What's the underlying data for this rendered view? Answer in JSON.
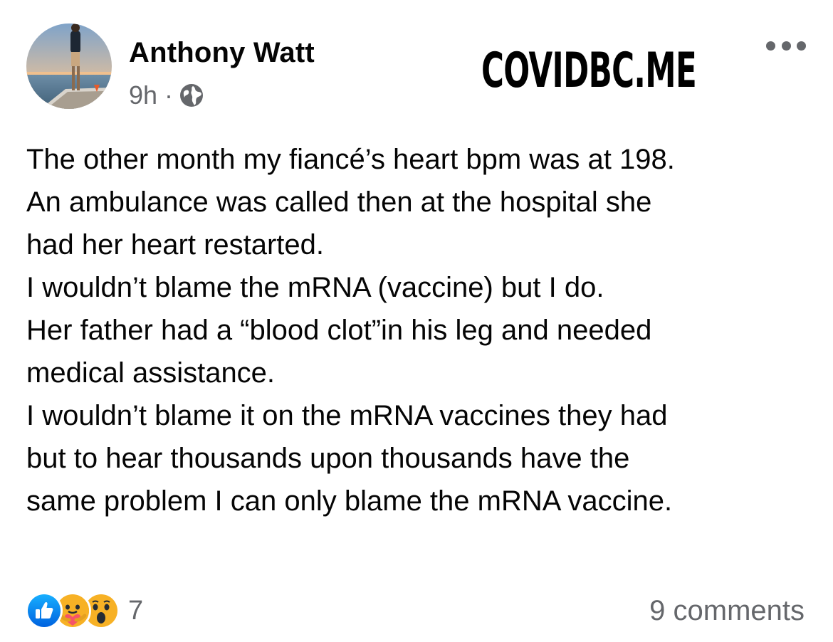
{
  "post": {
    "author": "Anthony Watt",
    "time": "9h",
    "separator": "·",
    "audience_icon": "globe-icon",
    "body_lines": [
      "The other month my fiancé’s heart bpm was at 198.",
      "An ambulance was called then at the hospital she",
      "had her heart restarted.",
      "I wouldn’t blame the mRNA (vaccine) but I do.",
      "Her father had a “blood clot”in his leg and needed",
      "medical assistance.",
      "I wouldn’t blame it on the mRNA vaccines they had",
      "but to hear thousands upon thousands have the",
      "same problem I can only blame the mRNA vaccine."
    ]
  },
  "watermark": "COVIDBC.ME",
  "more_options_icon": "more-horizontal-icon",
  "footer": {
    "reaction_icons": [
      "like-icon",
      "care-icon",
      "wow-icon"
    ],
    "reaction_count": "7",
    "comments": "9 comments"
  },
  "colors": {
    "text": "#050505",
    "secondary_text": "#65676b",
    "like_blue": "#1877f2",
    "reaction_yellow": "#f7b125"
  }
}
